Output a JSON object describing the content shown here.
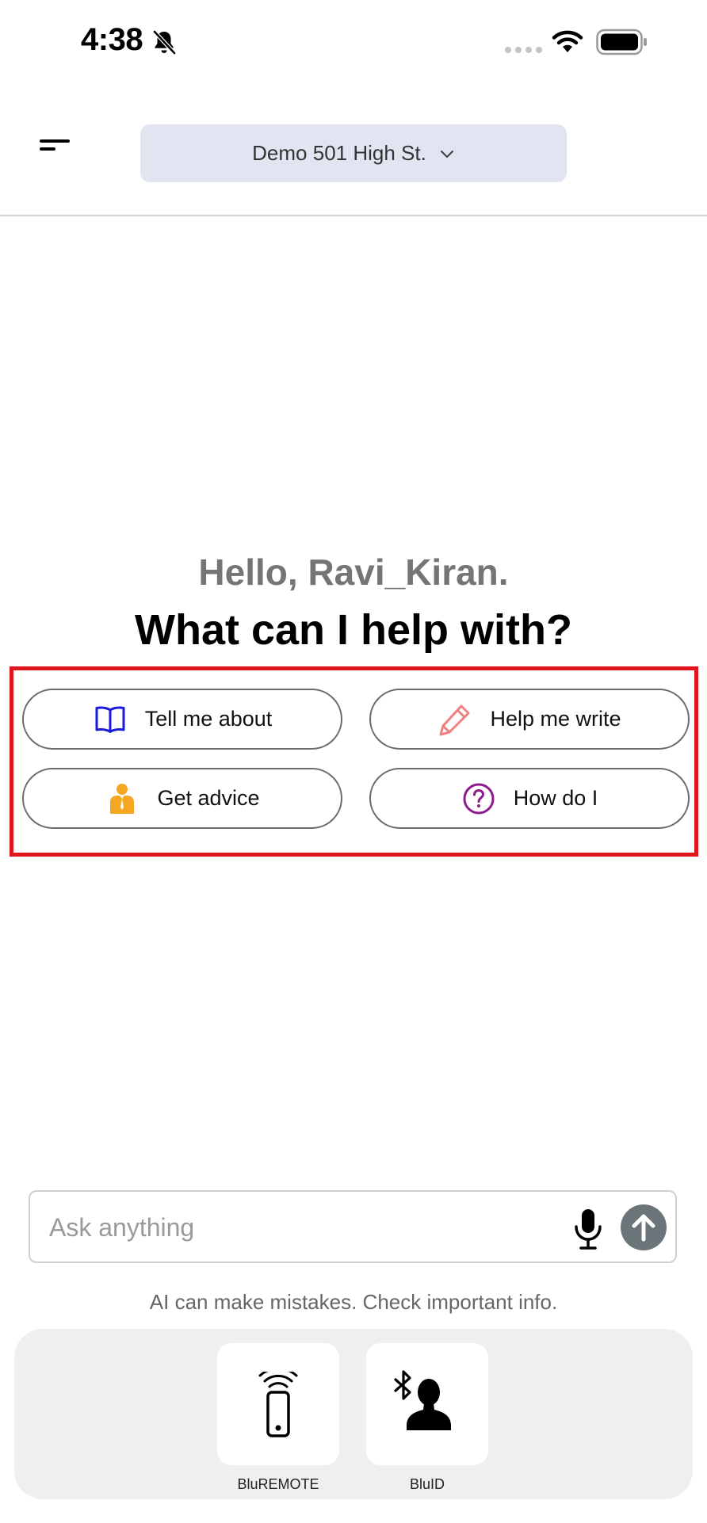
{
  "status_bar": {
    "time": "4:38",
    "icons": [
      "bell-slash-icon",
      "signal-dots-icon",
      "wifi-icon",
      "battery-icon"
    ]
  },
  "header": {
    "menu_icon": "hamburger-menu-icon",
    "location": "Demo 501 High St.",
    "dropdown_icon": "chevron-down-icon"
  },
  "greeting": {
    "hello": "Hello, Ravi_Kiran.",
    "prompt": "What can I help with?"
  },
  "suggestions": [
    {
      "label": "Tell me about",
      "icon": "open-book-icon",
      "icon_color": "#1a1adf"
    },
    {
      "label": "Help me write",
      "icon": "pencil-icon",
      "icon_color": "#f08080"
    },
    {
      "label": "Get advice",
      "icon": "advisor-person-icon",
      "icon_color": "#f5a623"
    },
    {
      "label": "How do I",
      "icon": "question-circle-icon",
      "icon_color": "#8e1a8e"
    }
  ],
  "input": {
    "placeholder": "Ask anything",
    "value": "",
    "mic_icon": "microphone-icon",
    "send_icon": "arrow-up-icon"
  },
  "disclaimer": "AI can make mistakes. Check important info.",
  "dock": {
    "items": [
      {
        "label": "BluREMOTE",
        "icon": "phone-wireless-icon"
      },
      {
        "label": "BluID",
        "icon": "bluetooth-person-icon"
      }
    ]
  },
  "colors": {
    "selector_bg": "#e1e5f1",
    "highlight_border": "#e0161e",
    "send_button": "#6b7479",
    "dock_bg": "#efefef"
  }
}
